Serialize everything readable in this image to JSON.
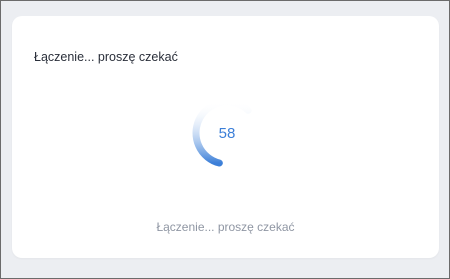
{
  "dialog": {
    "title": "Łączenie... proszę czekać",
    "status_text": "Łączenie... proszę czekać"
  },
  "spinner": {
    "icon": "loading-spinner-icon",
    "value_label": "58",
    "progress": 0.58,
    "accent_color": "#3c7fd8",
    "track_color": "#dce8f8"
  }
}
